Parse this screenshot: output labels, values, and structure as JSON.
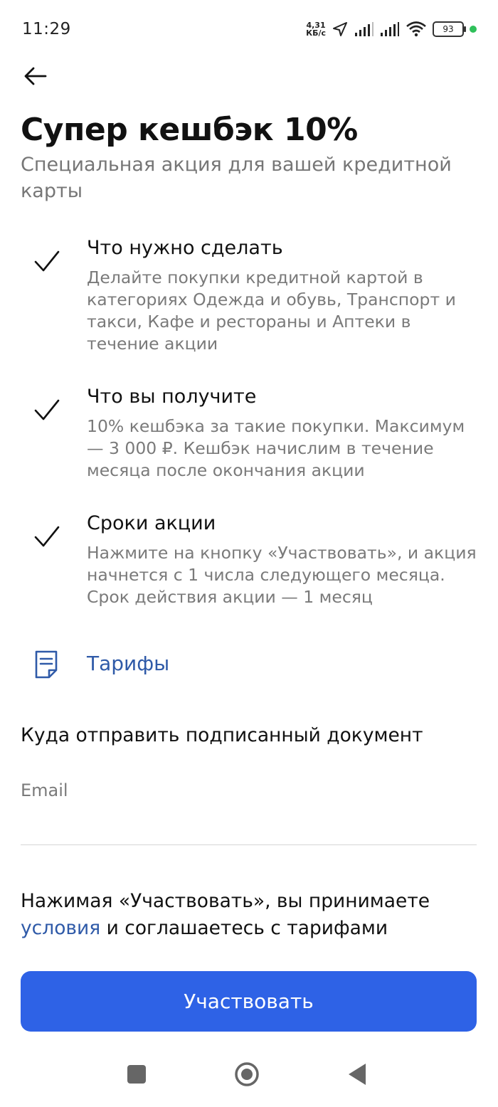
{
  "status_bar": {
    "time": "11:29",
    "net_speed_value": "4,31",
    "net_speed_unit": "КБ/с",
    "battery": "93"
  },
  "header": {
    "title": "Супер кешбэк 10%",
    "subtitle": "Специальная акция для вашей кредитной карты"
  },
  "features": [
    {
      "title": "Что нужно сделать",
      "text": "Делайте покупки кредитной картой в категориях Одежда и обувь, Транспорт и такси, Кафе и рестораны и Аптеки в течение акции"
    },
    {
      "title": "Что вы получите",
      "text": "10% кешбэка за такие покупки. Максимум — 3 000 ₽. Кешбэк начислим в течение месяца после окончания акции"
    },
    {
      "title": "Сроки акции",
      "text": "Нажмите на кнопку «Участвовать», и акция начнется с 1 числа следующего месяца. Срок действия акции — 1 месяц"
    }
  ],
  "tariffs": {
    "label": "Тарифы"
  },
  "document": {
    "section_title": "Куда отправить подписанный документ",
    "email_label": "Email",
    "email_value": ""
  },
  "consent": {
    "prefix": "Нажимая «Участвовать», вы принимаете ",
    "link": "условия",
    "suffix": " и соглашаетесь с тарифами"
  },
  "cta": {
    "label": "Участвовать"
  },
  "colors": {
    "accent": "#2e62e6",
    "link": "#2f5aa8",
    "secondary_text": "#7a7a7a"
  }
}
